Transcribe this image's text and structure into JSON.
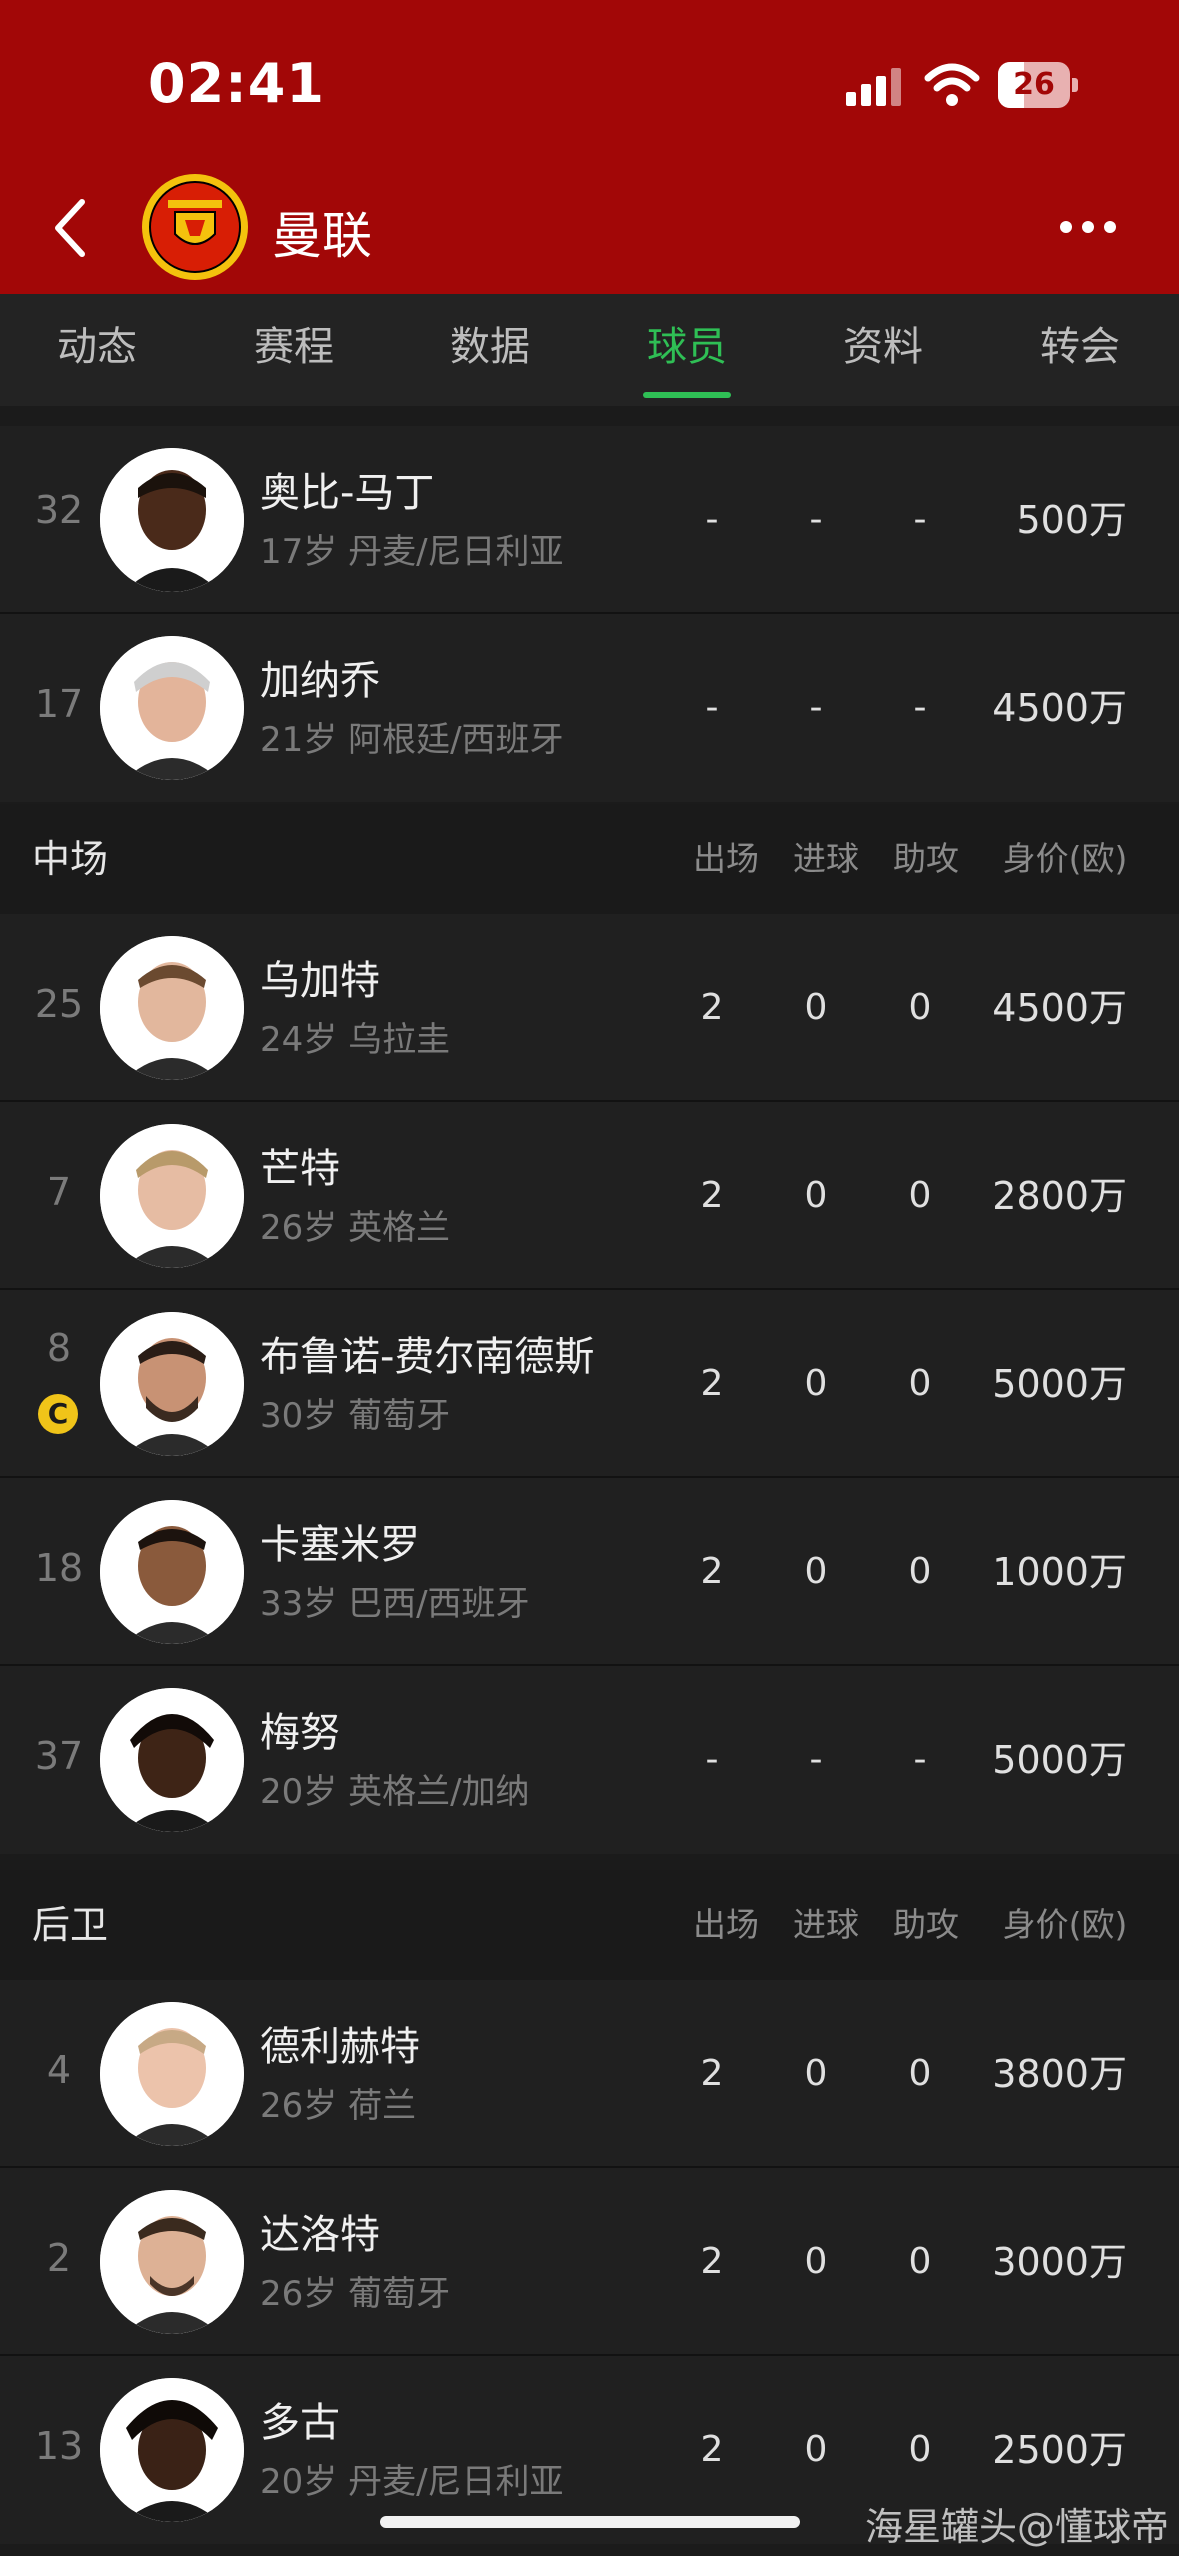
{
  "status": {
    "time": "02:41",
    "battery": "26"
  },
  "header": {
    "club_name": "曼联"
  },
  "tabs": [
    {
      "label": "动态",
      "active": false
    },
    {
      "label": "赛程",
      "active": false
    },
    {
      "label": "数据",
      "active": false
    },
    {
      "label": "球员",
      "active": true
    },
    {
      "label": "资料",
      "active": false
    },
    {
      "label": "转会",
      "active": false
    }
  ],
  "columns": {
    "apps": "出场",
    "goals": "进球",
    "assists": "助攻",
    "value": "身价(欧)"
  },
  "forwards_tail": [
    {
      "number": "32",
      "name": "奥比-马丁",
      "age": "17岁",
      "nation": "丹麦/尼日利亚",
      "apps": "-",
      "goals": "-",
      "assists": "-",
      "value": "500万"
    },
    {
      "number": "17",
      "name": "加纳乔",
      "age": "21岁",
      "nation": "阿根廷/西班牙",
      "apps": "-",
      "goals": "-",
      "assists": "-",
      "value": "4500万"
    }
  ],
  "midfield": {
    "title": "中场",
    "players": [
      {
        "number": "25",
        "name": "乌加特",
        "age": "24岁",
        "nation": "乌拉圭",
        "apps": "2",
        "goals": "0",
        "assists": "0",
        "value": "4500万"
      },
      {
        "number": "7",
        "name": "芒特",
        "age": "26岁",
        "nation": "英格兰",
        "apps": "2",
        "goals": "0",
        "assists": "0",
        "value": "2800万"
      },
      {
        "number": "8",
        "captain": "C",
        "name": "布鲁诺-费尔南德斯",
        "age": "30岁",
        "nation": "葡萄牙",
        "apps": "2",
        "goals": "0",
        "assists": "0",
        "value": "5000万"
      },
      {
        "number": "18",
        "name": "卡塞米罗",
        "age": "33岁",
        "nation": "巴西/西班牙",
        "apps": "2",
        "goals": "0",
        "assists": "0",
        "value": "1000万"
      },
      {
        "number": "37",
        "name": "梅努",
        "age": "20岁",
        "nation": "英格兰/加纳",
        "apps": "-",
        "goals": "-",
        "assists": "-",
        "value": "5000万"
      }
    ]
  },
  "defence": {
    "title": "后卫",
    "players": [
      {
        "number": "4",
        "name": "德利赫特",
        "age": "26岁",
        "nation": "荷兰",
        "apps": "2",
        "goals": "0",
        "assists": "0",
        "value": "3800万"
      },
      {
        "number": "2",
        "name": "达洛特",
        "age": "26岁",
        "nation": "葡萄牙",
        "apps": "2",
        "goals": "0",
        "assists": "0",
        "value": "3000万"
      },
      {
        "number": "13",
        "name": "多古",
        "age": "20岁",
        "nation": "丹麦/尼日利亚",
        "apps": "2",
        "goals": "0",
        "assists": "0",
        "value": "2500万"
      }
    ]
  },
  "watermark": "海星罐头@懂球帝"
}
